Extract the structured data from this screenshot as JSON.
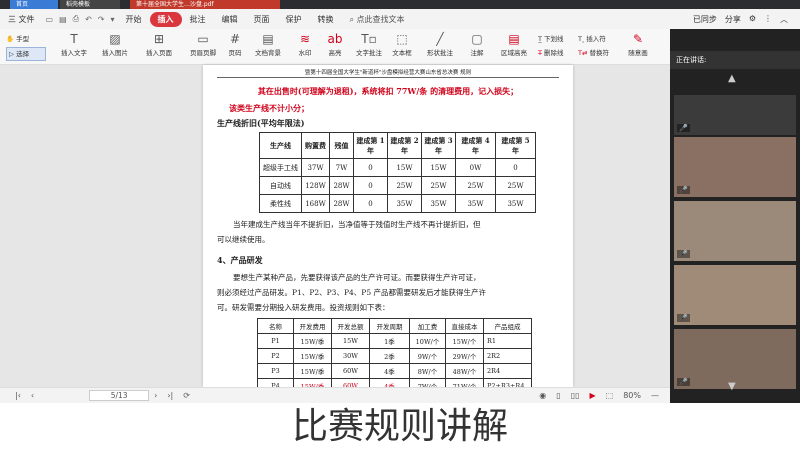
{
  "tabs": [
    "首页",
    "稻壳模板",
    "第十届全国大学生…沙盘.pdf"
  ],
  "menu": {
    "file": "三 文件",
    "items": [
      "开始",
      "插入",
      "批注",
      "编辑",
      "页面",
      "保护",
      "转换"
    ],
    "active_index": 1,
    "search": "点此查找文本",
    "sync": "已同步",
    "share": "分享"
  },
  "toolbar": {
    "left_tools": [
      {
        "icon": "✋",
        "label": "手型"
      },
      {
        "icon": "▷",
        "label": "选择"
      }
    ],
    "buttons": [
      "插入文字",
      "插入图片",
      "插入页面",
      "页眉页脚",
      "页码",
      "文档背景",
      "水印",
      "高亮",
      "文字批注",
      "文本框",
      "形状批注",
      "注解",
      "区域高亮",
      "下划线",
      "删除线",
      "插入符",
      "替换符",
      "随意画"
    ]
  },
  "document": {
    "header": "暨第十四届全国大学生\"新道杯\"沙盘模拟经营大赛山东省总决赛 规则",
    "red_note_1": "其在出售时(可理解为退租)，系统将扣 77W/条 的清理费用，记入损失；",
    "red_note_2": "该类生产线不计小分；",
    "subheading": "生产线折旧(平均年限法)",
    "depr_table": {
      "headers": [
        "生产线",
        "购置费",
        "残值",
        "建成第 1 年",
        "建成第 2 年",
        "建成第 3 年",
        "建成第 4 年",
        "建成第 5 年"
      ],
      "rows": [
        [
          "超级手工线",
          "37W",
          "7W",
          "0",
          "15W",
          "15W",
          "0W",
          "0"
        ],
        [
          "自动线",
          "128W",
          "28W",
          "0",
          "25W",
          "25W",
          "25W",
          "25W"
        ],
        [
          "柔性线",
          "168W",
          "28W",
          "0",
          "35W",
          "35W",
          "35W",
          "35W"
        ]
      ]
    },
    "para_1a": "当年建成生产线当年不提折旧，当净值等于残值时生产线不再计提折旧，但",
    "para_1b": "可以继续使用。",
    "section_title": "4、产品研发",
    "para_2a": "要想生产某种产品，先要获得该产品的生产许可证。而要获得生产许可证，",
    "para_2b": "则必须经过产品研发。P1、P2、P3、P4、P5 产品都需要研发后才能获得生产许",
    "para_2c": "可。研发需要分期投入研发费用。投资规则如下表：",
    "rd_table": {
      "headers": [
        "名称",
        "开发费用",
        "开发总额",
        "开发周期",
        "加工费",
        "直接成本",
        "产品组成"
      ],
      "rows": [
        [
          "P1",
          "15W/季",
          "15W",
          "1季",
          "10W/个",
          "15W/个",
          "R1"
        ],
        [
          "P2",
          "15W/季",
          "30W",
          "2季",
          "9W/个",
          "29W/个",
          "2R2"
        ],
        [
          "P3",
          "15W/季",
          "60W",
          "4季",
          "8W/个",
          "48W/个",
          "2R4"
        ],
        [
          "P4",
          "15W/季",
          "60W",
          "4季",
          "7W/个",
          "71W/个",
          "P2+R3+R4"
        ]
      ]
    }
  },
  "statusbar": {
    "page": "5/13",
    "zoom": "80%"
  },
  "video_panel": {
    "title": "正在讲话:",
    "colors": [
      "#3b3b3b",
      "#8a6f63",
      "#9b8a7a",
      "#a08a78",
      "#7f6a5e"
    ]
  },
  "caption": "比赛规则讲解"
}
